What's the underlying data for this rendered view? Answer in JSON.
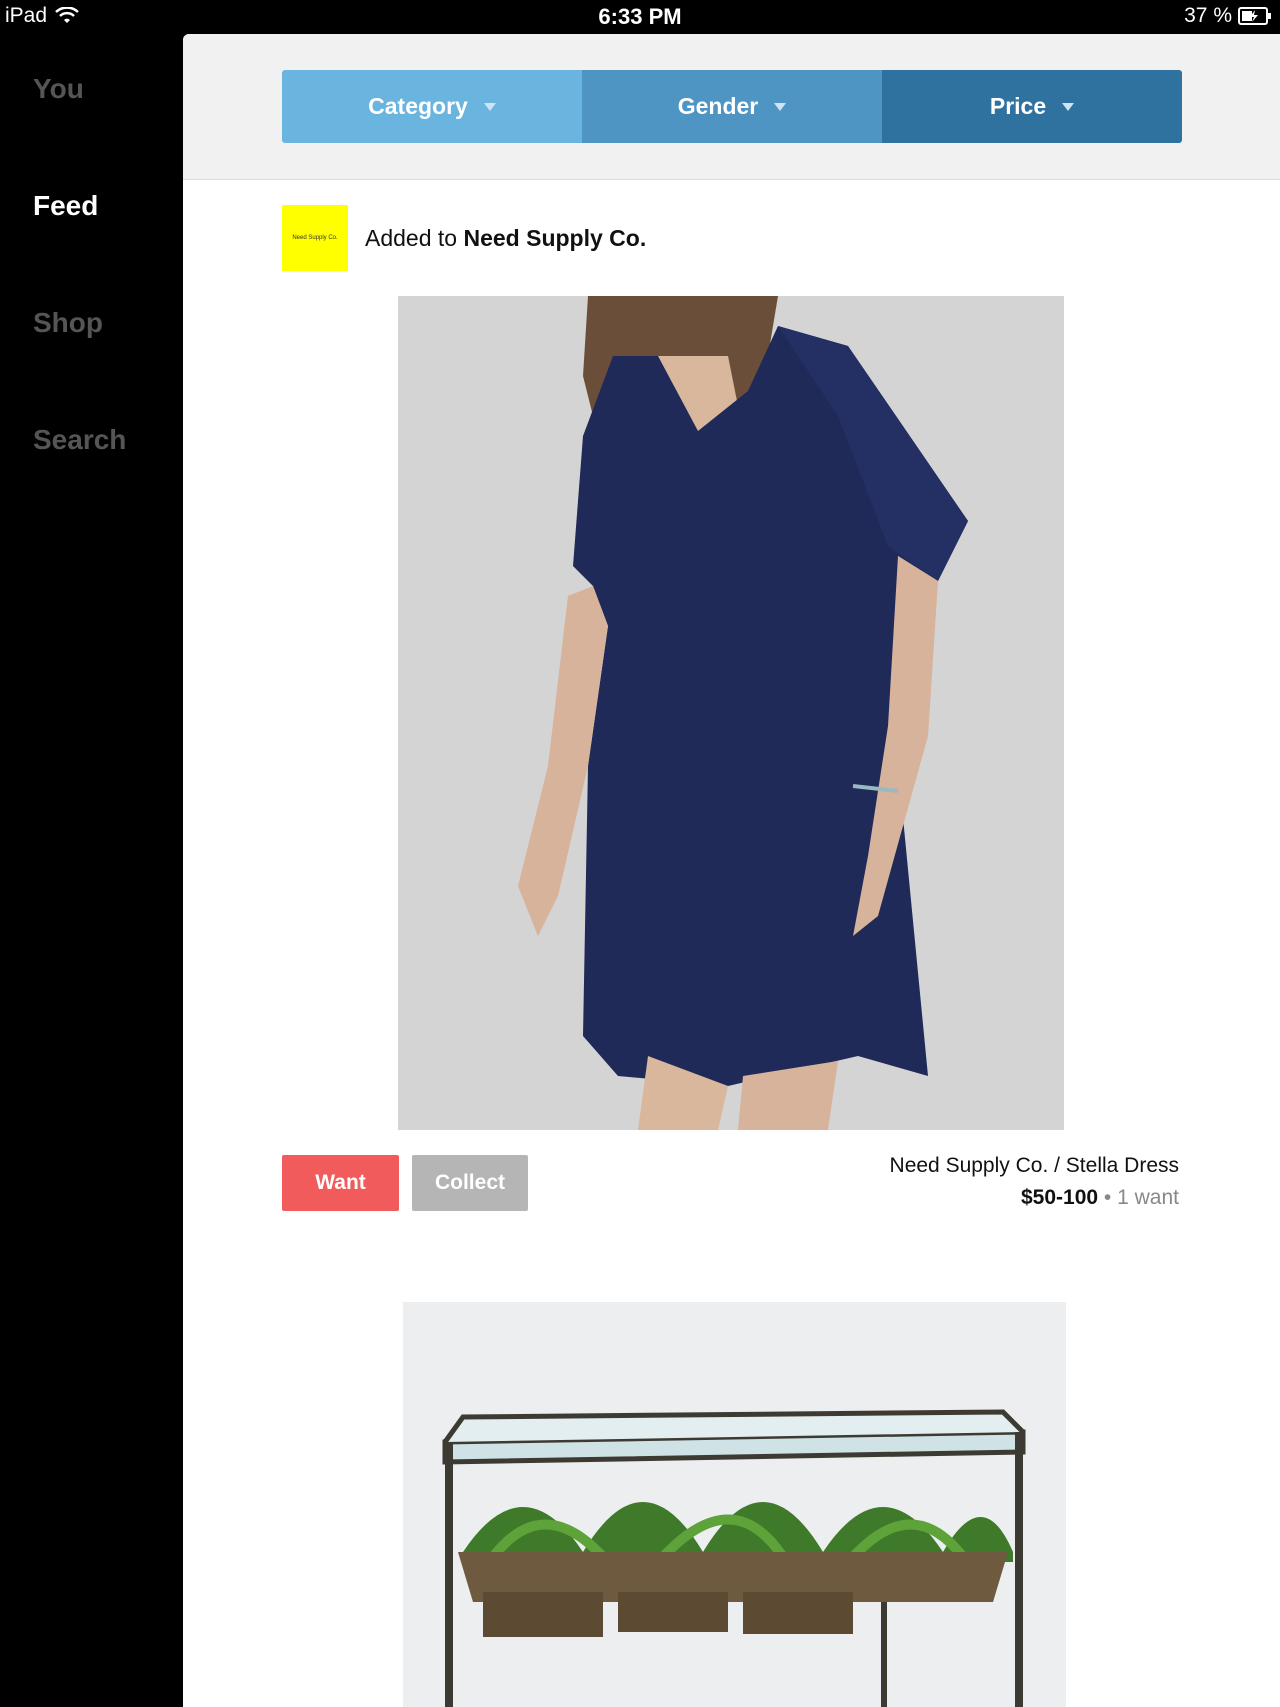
{
  "status_bar": {
    "device": "iPad",
    "time": "6:33 PM",
    "battery": "37 %"
  },
  "sidebar": {
    "items": [
      {
        "label": "You"
      },
      {
        "label": "Feed"
      },
      {
        "label": "Shop"
      },
      {
        "label": "Search"
      }
    ],
    "active": "Feed"
  },
  "filters": [
    {
      "label": "Category"
    },
    {
      "label": "Gender"
    },
    {
      "label": "Price"
    }
  ],
  "feed": {
    "items": [
      {
        "action_text": "Added to",
        "store_name": "Need Supply Co.",
        "store_logo_text": "Need Supply Co.",
        "product_title": "Need Supply Co. / Stella Dress",
        "price": "$50-100",
        "separator": "•",
        "wants": "1 want",
        "want_label": "Want",
        "collect_label": "Collect"
      }
    ]
  },
  "colors": {
    "filter_category": "#6ab4e0",
    "filter_gender": "#4e95c4",
    "filter_price": "#2f72a0",
    "want_button": "#f15b5b",
    "collect_button": "#b5b5b5",
    "store_logo_bg": "#ffff00"
  }
}
